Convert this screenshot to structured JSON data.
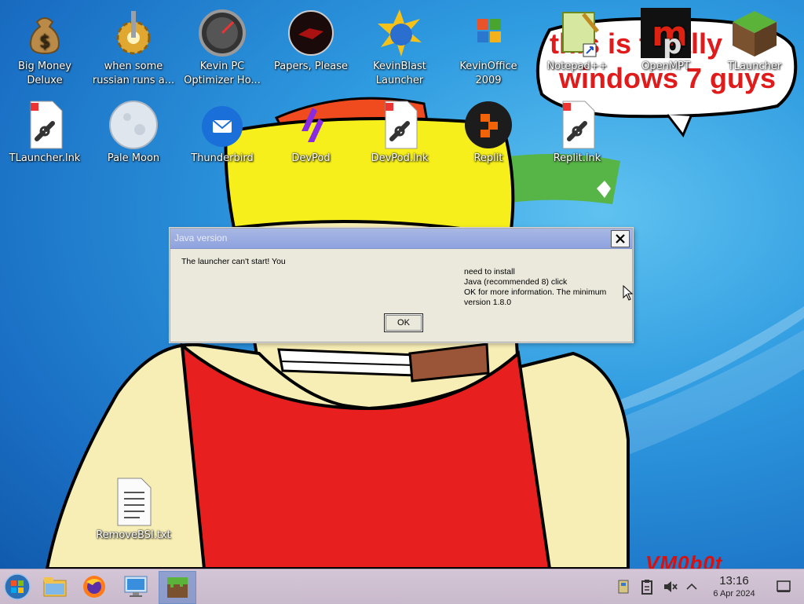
{
  "desktop": {
    "icons": [
      {
        "label": "Big Money Deluxe"
      },
      {
        "label": "when some russian runs a..."
      },
      {
        "label": "Kevin PC Optimizer Ho..."
      },
      {
        "label": "Papers, Please"
      },
      {
        "label": "KevinBlast Launcher"
      },
      {
        "label": "KevinOffice 2009"
      },
      {
        "label": "Notepad++"
      },
      {
        "label": "OpenMPT"
      },
      {
        "label": "TLauncher"
      },
      {
        "label": "TLauncher.lnk"
      },
      {
        "label": "Pale Moon"
      },
      {
        "label": "Thunderbird"
      },
      {
        "label": "DevPod"
      },
      {
        "label": "DevPod.lnk"
      },
      {
        "label": "Replit"
      },
      {
        "label": "Replit.lnk"
      },
      {
        "label": "RemoveBSI.txt"
      }
    ]
  },
  "wallpaper": {
    "bubble_line1": "this is totally",
    "bubble_line2": "windows 7 guys",
    "watermark": "VM0b0t"
  },
  "dialog": {
    "title": "Java version",
    "message_part1": "The launcher can't start! You",
    "message_lines": [
      "need to install",
      "Java (recommended 8) click",
      "OK for more information. The minimum",
      "version 1.8.0"
    ],
    "ok_label": "OK",
    "close_icon": "close-icon"
  },
  "taskbar": {
    "start_icon": "windows-orb-icon",
    "pinned": [
      "file-explorer-icon",
      "firefox-icon",
      "remote-desktop-icon",
      "minecraft-icon"
    ],
    "tray": [
      "usb-icon",
      "clipboard-icon",
      "volume-muted-icon",
      "chevron-up-icon",
      "show-desktop-icon"
    ],
    "clock_time": "13:16",
    "clock_date": "6 Apr 2024"
  },
  "colors": {
    "bubble_text": "#e01b1b",
    "dialog_title": "#8fa2de",
    "taskbar": "#cdbfcf"
  }
}
